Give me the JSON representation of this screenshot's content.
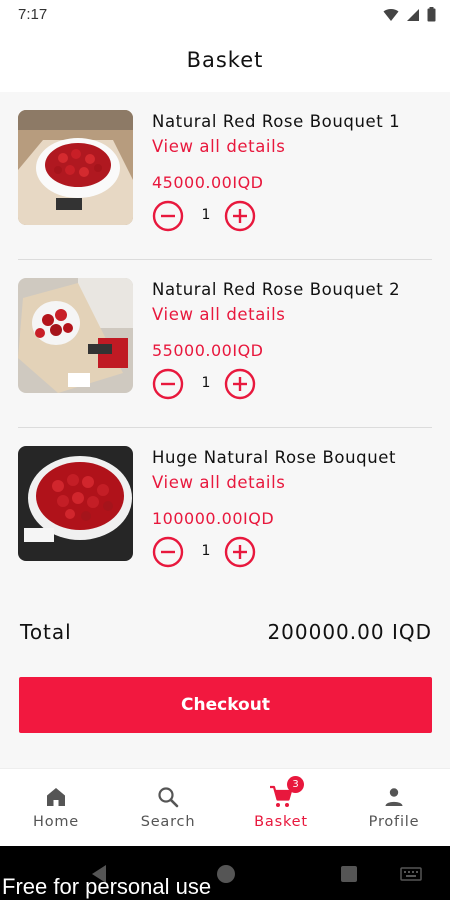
{
  "status_bar": {
    "time": "7:17"
  },
  "header": {
    "title": "Basket"
  },
  "cart": {
    "items": [
      {
        "name": "Natural Red Rose Bouquet 1",
        "details_link": "View all details",
        "price": "45000.00IQD",
        "quantity": "1"
      },
      {
        "name": "Natural Red Rose Bouquet 2",
        "details_link": "View all details",
        "price": "55000.00IQD",
        "quantity": "1"
      },
      {
        "name": "Huge Natural Rose Bouquet",
        "details_link": "View all details",
        "price": "100000.00IQD",
        "quantity": "1"
      }
    ]
  },
  "summary": {
    "total_label": "Total",
    "total_value": "200000.00 IQD"
  },
  "checkout": {
    "label": "Checkout"
  },
  "bottom_nav": {
    "items": [
      {
        "label": "Home",
        "icon": "home-icon"
      },
      {
        "label": "Search",
        "icon": "search-icon"
      },
      {
        "label": "Basket",
        "icon": "cart-icon",
        "badge": "3",
        "active": true
      },
      {
        "label": "Profile",
        "icon": "person-icon"
      }
    ]
  },
  "watermark": {
    "text": "Free for personal use"
  },
  "colors": {
    "accent": "#e8183d",
    "button": "#f2183f",
    "background": "#f7f7f7"
  }
}
